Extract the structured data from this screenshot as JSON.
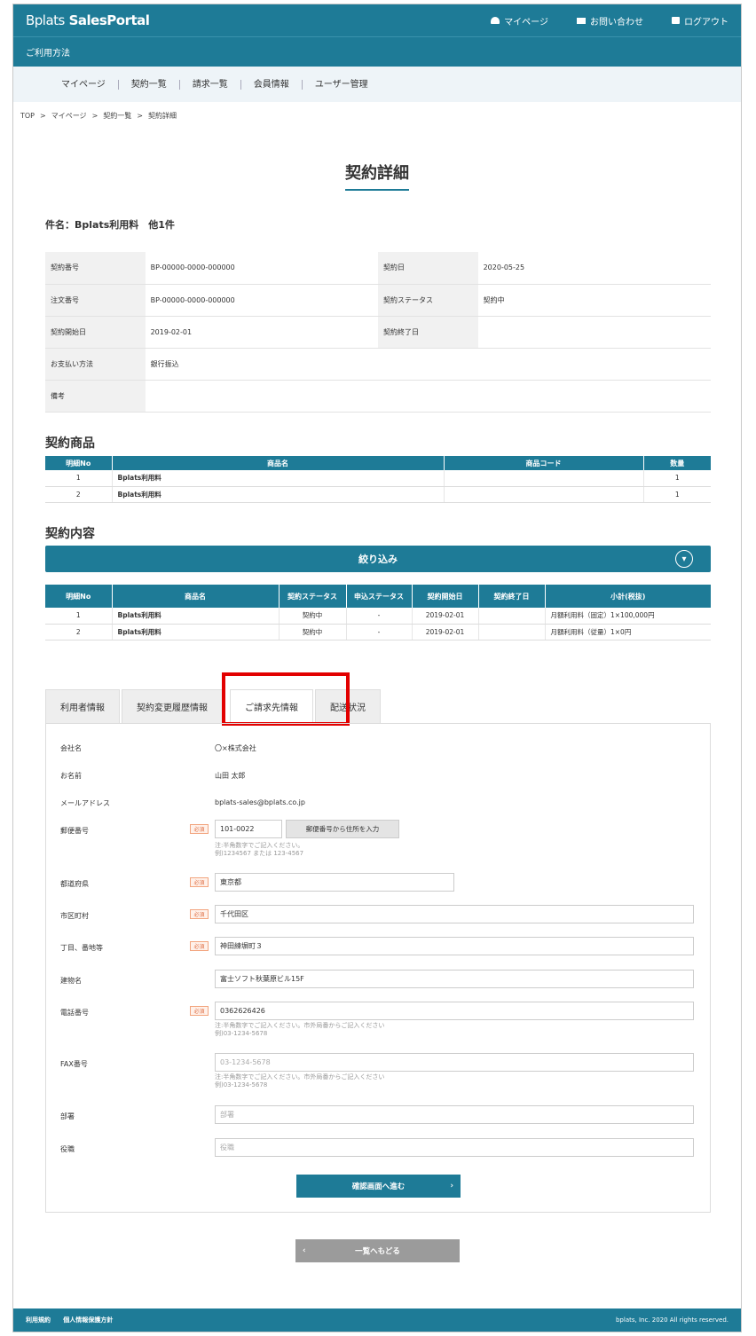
{
  "header": {
    "logo_prefix": "Bplats",
    "logo_suffix": "SalesPortal",
    "nav": [
      {
        "label": "マイページ",
        "icon": "user-icon"
      },
      {
        "label": "お問い合わせ",
        "icon": "mail-icon"
      },
      {
        "label": "ログアウト",
        "icon": "lock-icon"
      }
    ],
    "sub_link": "ご利用方法"
  },
  "menu": [
    "マイページ",
    "契約一覧",
    "請求一覧",
    "会員情報",
    "ユーザー管理"
  ],
  "breadcrumb": [
    "TOP",
    ">",
    "マイページ",
    ">",
    "契約一覧",
    ">",
    "契約詳細"
  ],
  "page_title": "契約詳細",
  "subject": "件名：Bplats利用料　他1件",
  "contract_info": {
    "contract_no_label": "契約番号",
    "contract_no": "BP-00000-0000-000000",
    "contract_date_label": "契約日",
    "contract_date": "2020-05-25",
    "order_no_label": "注文番号",
    "order_no": "BP-00000-0000-000000",
    "status_label": "契約ステータス",
    "status": "契約中",
    "start_label": "契約開始日",
    "start": "2019-02-01",
    "end_label": "契約終了日",
    "end": "",
    "payment_label": "お支払い方法",
    "payment": "銀行振込",
    "remarks_label": "備考",
    "remarks": ""
  },
  "products": {
    "heading": "契約商品",
    "columns": [
      "明細No",
      "商品名",
      "商品コード",
      "数量"
    ],
    "rows": [
      {
        "no": "1",
        "name": "Bplats利用料",
        "code": "",
        "qty": "1"
      },
      {
        "no": "2",
        "name": "Bplats利用料",
        "code": "",
        "qty": "1"
      }
    ]
  },
  "contents": {
    "heading": "契約内容",
    "filter_label": "絞り込み",
    "columns": [
      "明細No",
      "商品名",
      "契約ステータス",
      "申込ステータス",
      "契約開始日",
      "契約終了日",
      "小計(税抜)"
    ],
    "rows": [
      {
        "no": "1",
        "name": "Bplats利用料",
        "status": "契約中",
        "apply": "-",
        "start": "2019-02-01",
        "end": "",
        "subtotal": "月額利用料（固定）1×100,000円"
      },
      {
        "no": "2",
        "name": "Bplats利用料",
        "status": "契約中",
        "apply": "-",
        "start": "2019-02-01",
        "end": "",
        "subtotal": "月額利用料（従量）1×0円"
      }
    ]
  },
  "tabs": [
    "利用者情報",
    "契約変更履歴情報",
    "ご請求先情報",
    "配送状況"
  ],
  "billing_form": {
    "company_label": "会社名",
    "company": "〇×株式会社",
    "name_label": "お名前",
    "name": "山田 太郎",
    "email_label": "メールアドレス",
    "email": "bplats-sales@bplats.co.jp",
    "required": "必須",
    "zip_label": "郵便番号",
    "zip": "101-0022",
    "zip_button": "郵便番号から住所を入力",
    "zip_note_1": "注:半角数字でご記入ください。",
    "zip_note_2": "例)1234567 または 123-4567",
    "pref_label": "都道府県",
    "pref": "東京都",
    "city_label": "市区町村",
    "city": "千代田区",
    "address_label": "丁目、番地等",
    "address": "神田練塀町３",
    "building_label": "建物名",
    "building": "富士ソフト秋葉原ビル15F",
    "tel_label": "電話番号",
    "tel": "0362626426",
    "tel_note_1": "注:半角数字でご記入ください。市外局番からご記入ください",
    "tel_note_2": "例)03-1234-5678",
    "fax_label": "FAX番号",
    "fax_placeholder": "03-1234-5678",
    "fax_note_1": "注:半角数字でご記入ください。市外局番からご記入ください",
    "fax_note_2": "例)03-1234-5678",
    "dept_label": "部署",
    "dept_placeholder": "部署",
    "position_label": "役職",
    "position_placeholder": "役職",
    "confirm_button": "確認画面へ進む"
  },
  "back_button": "一覧へもどる",
  "footer": {
    "links": [
      "利用規約",
      "個人情報保護方針"
    ],
    "copyright": "bplats, Inc. 2020 All rights reserved."
  },
  "colors": {
    "primary": "#1e7b97",
    "highlight": "#e20000"
  }
}
